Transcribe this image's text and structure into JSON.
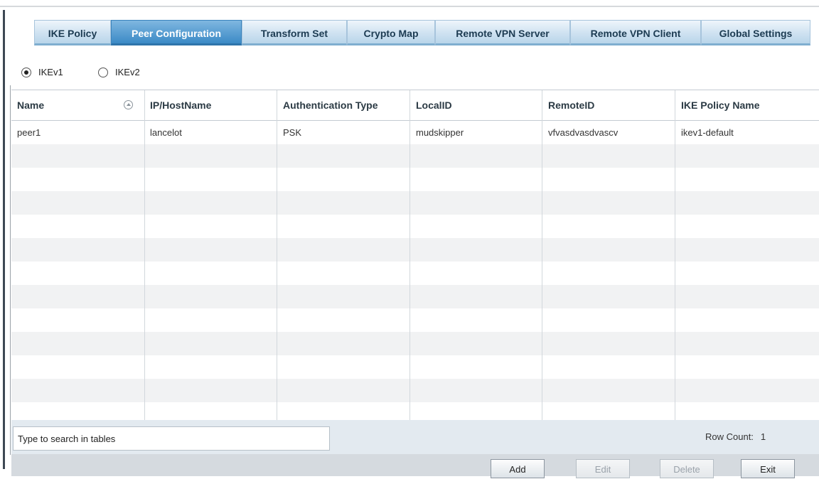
{
  "tabs": [
    {
      "label": "IKE Policy",
      "active": false
    },
    {
      "label": "Peer Configuration",
      "active": true
    },
    {
      "label": "Transform Set",
      "active": false
    },
    {
      "label": "Crypto Map",
      "active": false
    },
    {
      "label": "Remote VPN Server",
      "active": false
    },
    {
      "label": "Remote VPN Client",
      "active": false
    },
    {
      "label": "Global Settings",
      "active": false
    }
  ],
  "ike_version": {
    "options": [
      {
        "label": "IKEv1",
        "selected": true
      },
      {
        "label": "IKEv2",
        "selected": false
      }
    ]
  },
  "table": {
    "columns": [
      "Name",
      "IP/HostName",
      "Authentication Type",
      "LocalID",
      "RemoteID",
      "IKE Policy Name"
    ],
    "sort_icon": "sort-ascending-icon",
    "rows": [
      [
        "peer1",
        "lancelot",
        "PSK",
        "mudskipper",
        "vfvasdvasdvascv",
        "ikev1-default"
      ]
    ]
  },
  "footer": {
    "search_placeholder": "Type to search in tables",
    "row_count_label": "Row Count:",
    "row_count_value": "1"
  },
  "buttons": [
    {
      "label": "Add",
      "enabled": true
    },
    {
      "label": "Edit",
      "enabled": false
    },
    {
      "label": "Delete",
      "enabled": false
    },
    {
      "label": "Exit",
      "enabled": true
    }
  ],
  "colors": {
    "tab_active": "#3b8ac6",
    "tab_inactive": "#cfe2f1",
    "row_alt": "#f1f2f3",
    "footer_bg": "#e3eaf0"
  }
}
